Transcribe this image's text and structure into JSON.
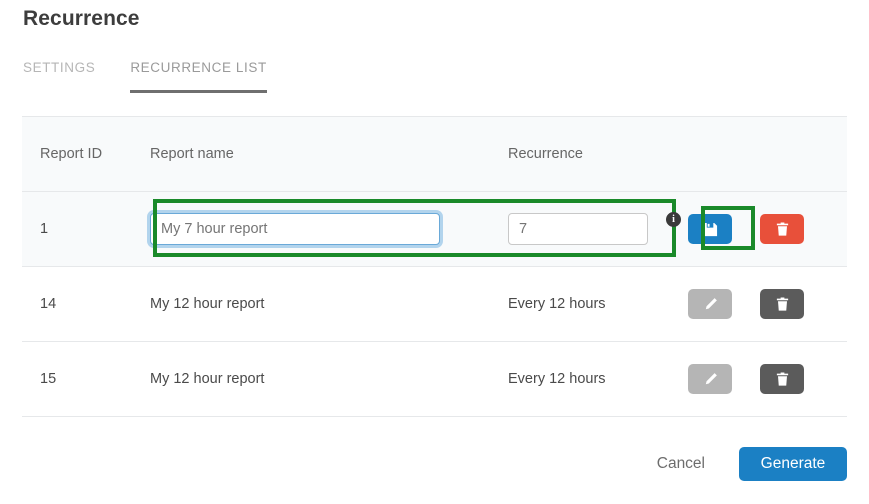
{
  "page": {
    "title": "Recurrence"
  },
  "tabs": [
    {
      "label": "SETTINGS",
      "active": false
    },
    {
      "label": "RECURRENCE LIST",
      "active": true
    }
  ],
  "table": {
    "columns": {
      "id": "Report ID",
      "name": "Report name",
      "recurrence": "Recurrence"
    },
    "edit_row": {
      "id": "1",
      "name_input": {
        "value": "",
        "placeholder": "My 7 hour report"
      },
      "recurrence_input": {
        "value": "",
        "placeholder": "7"
      },
      "info_badge": "i",
      "save_icon": "save-floppy-icon",
      "delete_icon": "trash-icon"
    },
    "rows": [
      {
        "id": "14",
        "name": "My 12 hour report",
        "recurrence": "Every 12 hours",
        "edit_icon": "pencil-icon",
        "delete_icon": "trash-icon"
      },
      {
        "id": "15",
        "name": "My 12 hour report",
        "recurrence": "Every 12 hours",
        "edit_icon": "pencil-icon",
        "delete_icon": "trash-icon"
      }
    ]
  },
  "footer": {
    "cancel_label": "Cancel",
    "generate_label": "Generate"
  },
  "colors": {
    "primary_blue": "#1b80c4",
    "danger_red": "#e8503a",
    "annotation_green": "#1a8a2a",
    "edit_gray": "#b5b5b5",
    "delete_gray": "#5b5b5b",
    "row_tint": "#f8fafb"
  }
}
